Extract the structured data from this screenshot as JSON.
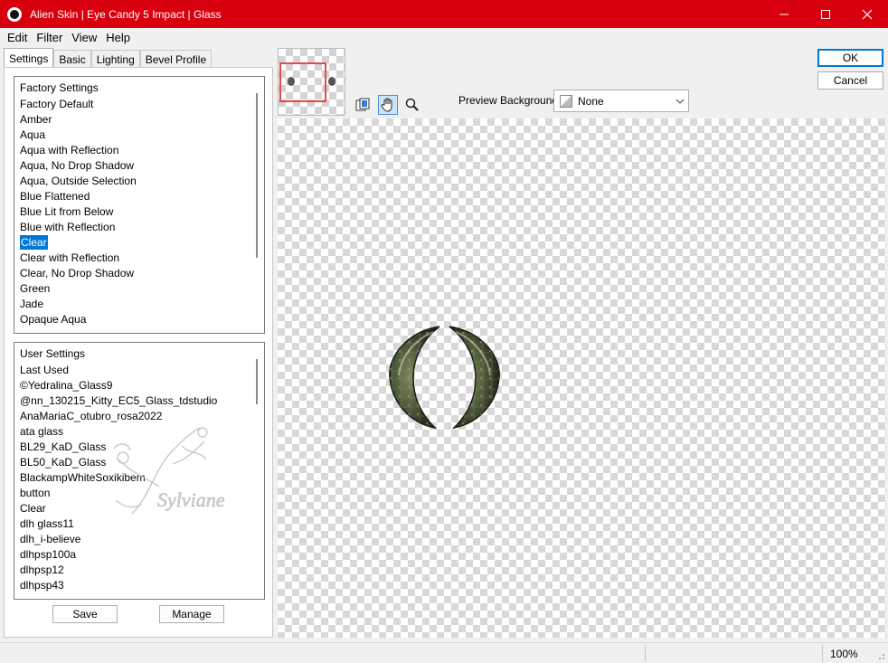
{
  "window": {
    "title": "Alien Skin | Eye Candy 5 Impact | Glass",
    "controls": [
      "minimize",
      "maximize",
      "close"
    ]
  },
  "menu": [
    "Edit",
    "Filter",
    "View",
    "Help"
  ],
  "tabs": [
    "Settings",
    "Basic",
    "Lighting",
    "Bevel Profile"
  ],
  "factory_settings": {
    "header": "Factory Settings",
    "items": [
      "Factory Default",
      "Amber",
      "Aqua",
      "Aqua with Reflection",
      "Aqua, No Drop Shadow",
      "Aqua, Outside Selection",
      "Blue Flattened",
      "Blue Lit from Below",
      "Blue with Reflection",
      "Clear",
      "Clear with Reflection",
      "Clear, No Drop Shadow",
      "Green",
      "Jade",
      "Opaque Aqua"
    ],
    "selected": "Clear"
  },
  "user_settings": {
    "header": "User Settings",
    "items": [
      "Last Used",
      "©Yedralina_Glass9",
      "@nn_130215_Kitty_EC5_Glass_tdstudio",
      "AnaMariaC_otubro_rosa2022",
      "ata glass",
      "BL29_KaD_Glass",
      "BL50_KaD_Glass",
      "BlackampWhiteSoxikibem",
      "button",
      "Clear",
      "dlh glass11",
      "dlh_i-believe",
      "dlhpsp100a",
      "dlhpsp12",
      "dlhpsp43"
    ]
  },
  "buttons": {
    "save": "Save",
    "manage": "Manage",
    "ok": "OK",
    "cancel": "Cancel"
  },
  "watermark": "Sylviane",
  "preview_background": {
    "label": "Preview Background:",
    "value": "None"
  },
  "tools": [
    "preview-compare-icon",
    "hand-pan-icon",
    "zoom-magnifier-icon"
  ],
  "status": {
    "zoom": "100%"
  },
  "colors": {
    "titlebar": "#d8000f",
    "selection": "#0078d7",
    "nav_rect": "#e54b4b"
  }
}
